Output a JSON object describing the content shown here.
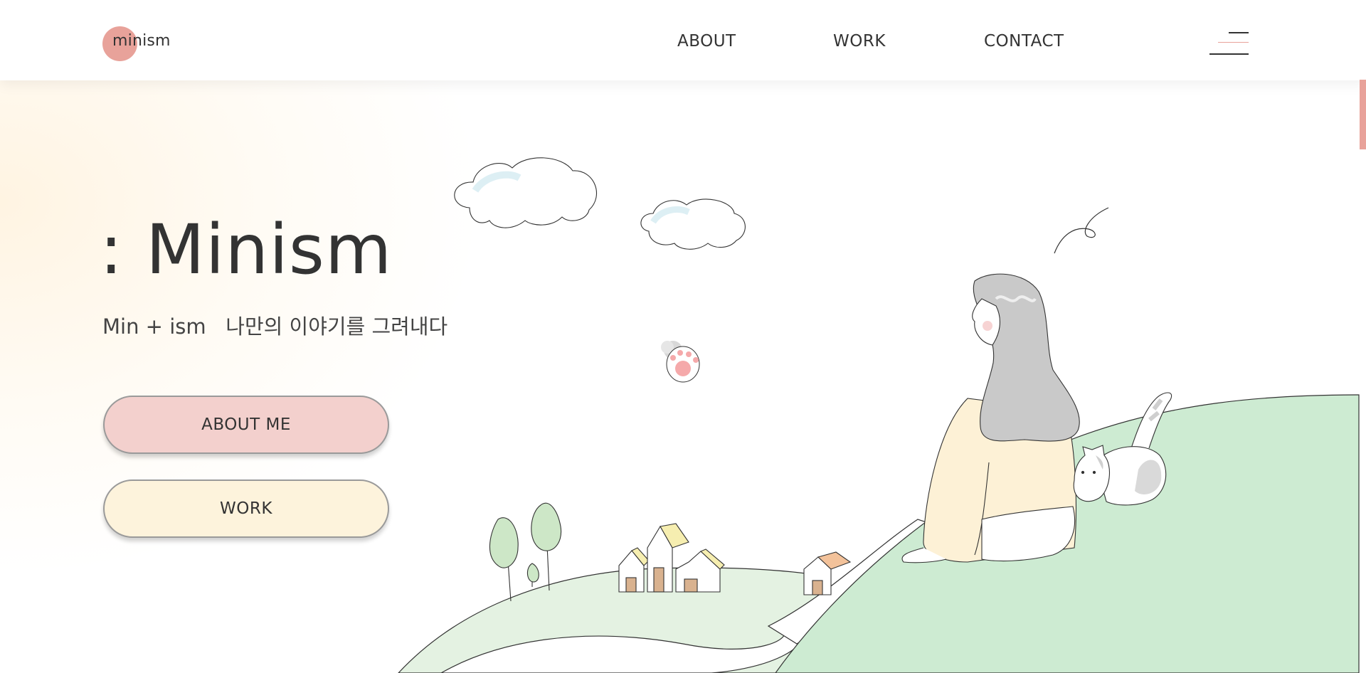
{
  "header": {
    "logo_text": "minism",
    "nav": [
      {
        "label": "ABOUT"
      },
      {
        "label": "WORK"
      },
      {
        "label": "CONTACT"
      }
    ]
  },
  "hero": {
    "title": ": Minism",
    "subtitle": "Min + ism   나만의 이야기를 그려내다",
    "buttons": {
      "about_me": "ABOUT ME",
      "work": "WORK"
    }
  },
  "colors": {
    "accent_pink": "#e8a29a",
    "button_pink": "#f3d0cd",
    "button_cream": "#fdf3dc",
    "hill_green": "#cdebd2",
    "text_dark": "#333333"
  },
  "icons": [
    "hamburger-menu-icon"
  ]
}
